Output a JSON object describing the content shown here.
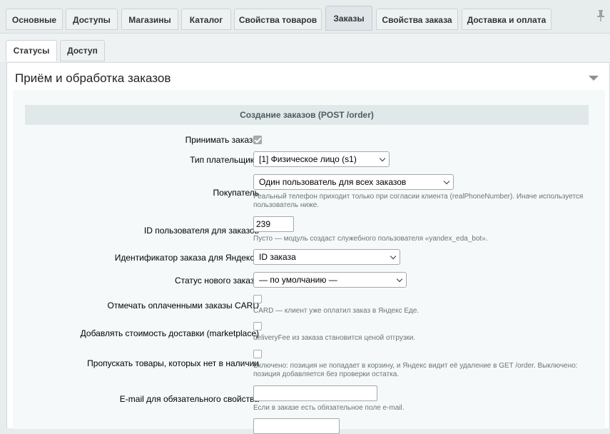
{
  "tabs": [
    "Основные",
    "Доступы",
    "Магазины",
    "Каталог",
    "Свойства товаров",
    "Заказы",
    "Свойства заказа",
    "Доставка и оплата"
  ],
  "subtabs": [
    "Статусы",
    "Доступ"
  ],
  "section": {
    "title": "Приём и обработка заказов"
  },
  "group": {
    "title": "Создание заказов (POST /order)"
  },
  "fields": {
    "accept": {
      "label": "Принимать заказы",
      "checked": true
    },
    "payer_type": {
      "label": "Тип плательщика",
      "value": "[1] Физическое лицо (s1)"
    },
    "buyer": {
      "label": "Покупатель",
      "value": "Один пользователь для всех заказов",
      "hint1": "Реальный телефон приходит только при согласии клиента (realPhoneNumber). Иначе используется",
      "hint2": "пользователь ниже."
    },
    "user_id": {
      "label": "ID пользователя для заказов",
      "value": "239",
      "hint": "Пусто — модуль создаст служебного пользователя «yandex_eda_bot»."
    },
    "order_id": {
      "label": "Идентификатор заказа для Яндекса",
      "value": "ID заказа"
    },
    "status": {
      "label": "Статус нового заказа",
      "value": "— по умолчанию —"
    },
    "paid_card": {
      "label": "Отмечать оплаченными заказы CARD",
      "checked": false,
      "hint": "CARD — клиент уже оплатил заказ в Яндекс Еде."
    },
    "delivery_cost": {
      "label": "Добавлять стоимость доставки (marketplace)",
      "checked": false,
      "hint": "deliveryFee из заказа становится ценой отгрузки."
    },
    "skip_missing": {
      "label": "Пропускать товары, которых нет в наличии",
      "checked": false,
      "hint1": "Включено: позиция не попадает в корзину, и Яндекс видит её удаление в GET /order. Выключено:",
      "hint2": "позиция добавляется без проверки остатка."
    },
    "email": {
      "label": "E-mail для обязательного свойства",
      "value": "",
      "hint": "Если в заказе есть обязательное поле e-mail."
    }
  }
}
